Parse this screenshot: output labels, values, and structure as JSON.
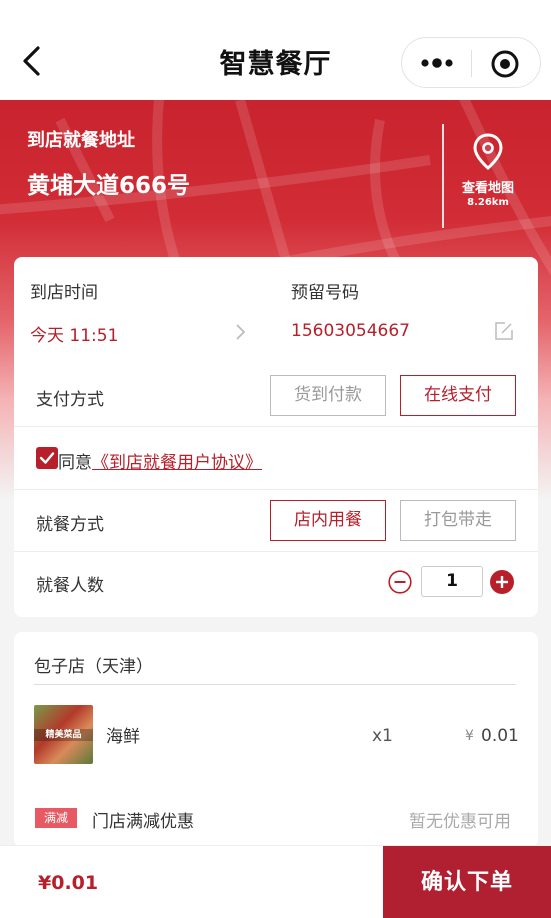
{
  "nav": {
    "title": "智慧餐厅"
  },
  "address": {
    "label": "到店就餐地址",
    "value": "黄埔大道666号",
    "map_label": "查看地图",
    "distance": "8.26km"
  },
  "arrival": {
    "label": "到店时间",
    "value": "今天 11:51"
  },
  "phone": {
    "label": "预留号码",
    "value": "15603054667"
  },
  "payment": {
    "label": "支付方式",
    "options": [
      "货到付款",
      "在线支付"
    ],
    "selected": "在线支付"
  },
  "agreement": {
    "prefix": "同意",
    "link": "《到店就餐用户协议》",
    "checked": true
  },
  "dining_mode": {
    "label": "就餐方式",
    "options": [
      "店内用餐",
      "打包带走"
    ],
    "selected": "店内用餐"
  },
  "diners": {
    "label": "就餐人数",
    "count": "1"
  },
  "order": {
    "store_name": "包子店（天津）",
    "items": [
      {
        "name": "海鲜",
        "thumb_text": "精美菜品",
        "qty": "x1",
        "currency": "¥",
        "price": "0.01"
      }
    ],
    "discount": {
      "badge": "满减",
      "label": "门店满减优惠",
      "value": "暂无优惠可用"
    }
  },
  "footer": {
    "total": "¥0.01",
    "confirm": "确认下单"
  },
  "colors": {
    "accent": "#b71f2a",
    "header_red": "#c8232e"
  },
  "icons": [
    "back-arrow-icon",
    "more-dots-icon",
    "target-circle-icon",
    "map-pin-icon",
    "chevron-right-icon",
    "edit-icon",
    "checkbox-checked-icon",
    "minus-circle-icon",
    "plus-circle-icon"
  ]
}
